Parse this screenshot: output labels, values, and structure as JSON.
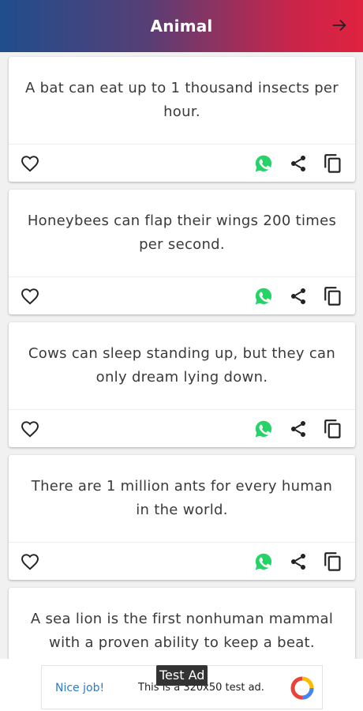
{
  "appbar": {
    "title": "Animal",
    "action_icon": "arrow-right-icon",
    "gradient": [
      "#1f4e8c",
      "#e0223f"
    ]
  },
  "colors": {
    "whatsapp": "#25d366",
    "icon": "#222222",
    "ad_link": "#2e79c9"
  },
  "facts": [
    {
      "text": "A bat can eat up to 1 thousand insects per hour."
    },
    {
      "text": "Honeybees can flap their wings 200 times per second."
    },
    {
      "text": "Cows can sleep standing up, but they can only dream lying down."
    },
    {
      "text": "There are 1 million ants for every human in the world."
    },
    {
      "text": "A sea lion is the first nonhuman mammal with a proven ability to keep a beat."
    }
  ],
  "actions": {
    "like_icon": "heart-icon",
    "whatsapp_icon": "whatsapp-icon",
    "share_icon": "share-icon",
    "copy_icon": "copy-icon"
  },
  "ad": {
    "tag": "Test Ad",
    "headline": "Nice job!",
    "description": "This is a 320x50 test ad.",
    "logo_icon": "ad-choices-logo-icon"
  }
}
